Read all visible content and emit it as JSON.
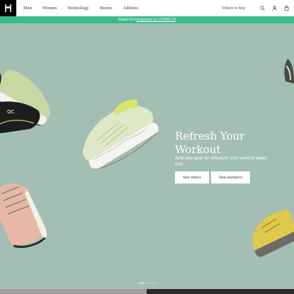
{
  "header": {
    "nav": [
      "Men",
      "Women",
      "Technology",
      "Stories",
      "Athletes"
    ],
    "where_to_buy": "Where to buy"
  },
  "banner": {
    "prefix": "Read On's ",
    "link": "response to COVID-19"
  },
  "hero": {
    "title": "Refresh Your Workout",
    "subtitle": "Bold new gear for wherever your workout takes you.",
    "cta_men": "See men's",
    "cta_women": "See women's",
    "slide_count": 3,
    "active_slide": 1
  },
  "colors": {
    "accent": "#3dba8c",
    "hero_bg": "#a3bfb3"
  }
}
